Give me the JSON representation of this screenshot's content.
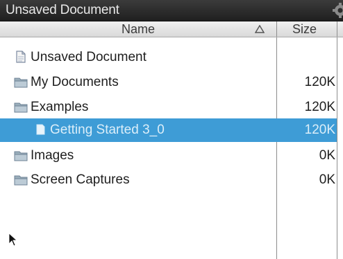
{
  "window": {
    "title": "Unsaved Document"
  },
  "icons": {
    "settings": "gear-icon",
    "sort": "sort-ascending-icon",
    "document": "document-icon",
    "folder": "folder-icon",
    "cursor": "mouse-pointer-icon"
  },
  "colors": {
    "titlebar": "#2a2a2a",
    "header": "#e4e4e4",
    "selected_row": "#3e9cd6"
  },
  "columns": {
    "name": "Name",
    "size": "Size"
  },
  "files": [
    {
      "name": "Unsaved Document",
      "size": "",
      "type": "document",
      "level": 0,
      "selected": false
    },
    {
      "name": "My Documents",
      "size": "120K",
      "type": "folder",
      "level": 0,
      "selected": false
    },
    {
      "name": "Examples",
      "size": "120K",
      "type": "folder",
      "level": 1,
      "selected": false
    },
    {
      "name": "Getting Started 3_0",
      "size": "120K",
      "type": "document",
      "level": 2,
      "selected": true
    },
    {
      "name": "Images",
      "size": "0K",
      "type": "folder",
      "level": 1,
      "selected": false
    },
    {
      "name": "Screen Captures",
      "size": "0K",
      "type": "folder",
      "level": 1,
      "selected": false
    }
  ]
}
